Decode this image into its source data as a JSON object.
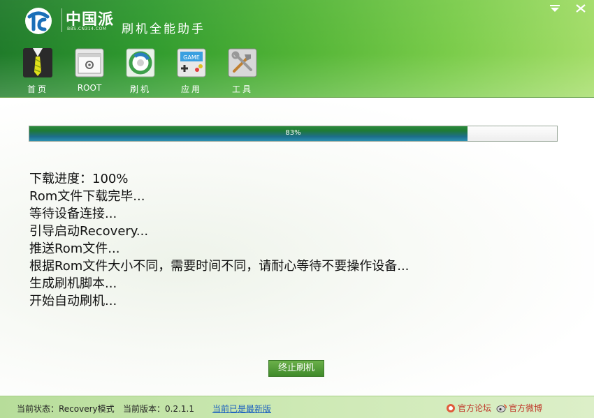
{
  "header": {
    "brand_name": "中国派",
    "brand_sub": "BBS.CN314.COM",
    "app_title": "刷机全能助手"
  },
  "nav": {
    "items": [
      {
        "label": "首页",
        "icon": "tie-icon"
      },
      {
        "label": "ROOT",
        "icon": "root-window-icon"
      },
      {
        "label": "刷机",
        "icon": "flash-refresh-icon"
      },
      {
        "label": "应用",
        "icon": "game-icon"
      },
      {
        "label": "工具",
        "icon": "tools-icon"
      }
    ]
  },
  "progress": {
    "percent": 83,
    "text": "83%"
  },
  "log": {
    "lines": [
      "下载进度：100%",
      "Rom文件下载完毕...",
      "等待设备连接...",
      "引导启动Recovery...",
      "推送Rom文件...",
      "根据Rom文件大小不同，需要时间不同，请耐心等待不要操作设备...",
      "生成刷机脚本...",
      "开始自动刷机..."
    ]
  },
  "buttons": {
    "stop_label": "终止刷机"
  },
  "status": {
    "state": "当前状态：Recovery模式",
    "version": "当前版本：0.2.1.1",
    "update": "当前已是最新版",
    "forum": "官方论坛",
    "weibo": "官方微博"
  },
  "colors": {
    "accent": "#3f8a2a",
    "progress": "#1f7a36"
  }
}
